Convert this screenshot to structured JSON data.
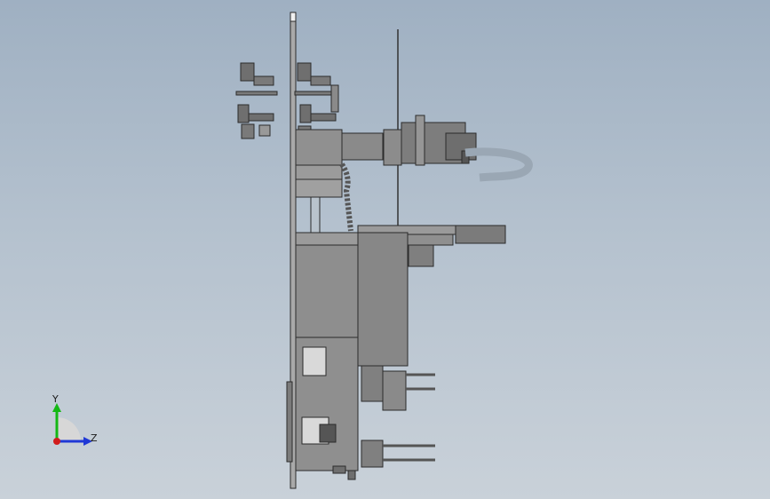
{
  "viewport": {
    "background_top": "#9fb0c2",
    "background_bottom": "#c9d1d9"
  },
  "triad": {
    "y_label": "Y",
    "z_label": "Z",
    "y_color": "#14b814",
    "z_color": "#1f38d6",
    "x_color": "#d11c1c"
  },
  "model": {
    "body_color": "#8e8e8e",
    "edge_color": "#2b2b2b"
  }
}
